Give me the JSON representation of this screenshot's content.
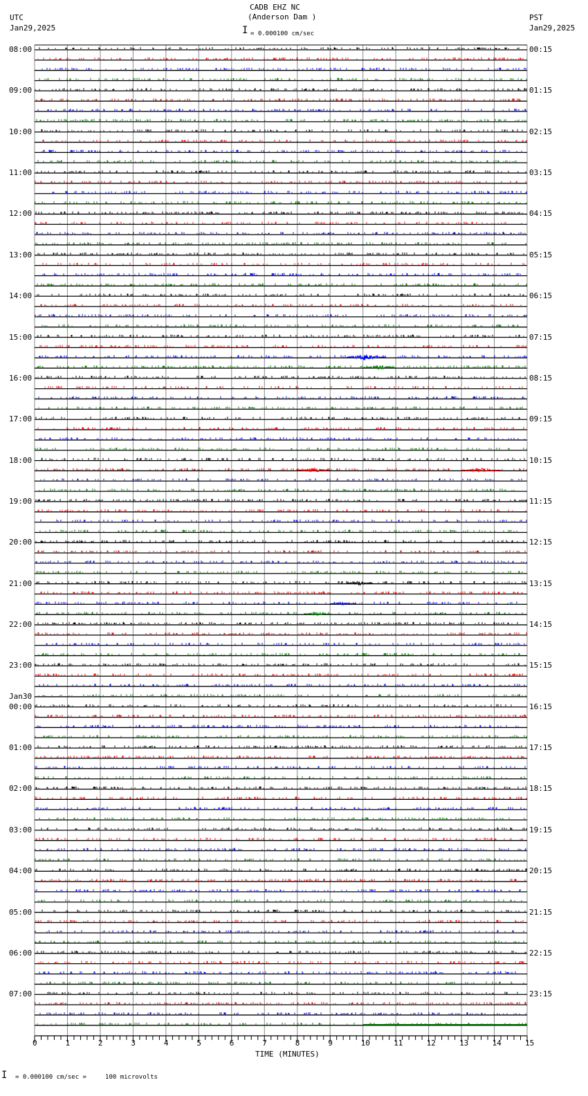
{
  "header": {
    "station": "CADB EHZ NC",
    "location": "(Anderson Dam )",
    "left_tz": "UTC",
    "left_date": "Jan29,2025",
    "right_tz": "PST",
    "right_date": "Jan29,2025",
    "scale": "= 0.000100 cm/sec"
  },
  "footer": {
    "scale": "= 0.000100 cm/sec =     100 microvolts"
  },
  "colors": {
    "cycle": [
      "#000000",
      "#ff0000",
      "#0000ff",
      "#008000"
    ],
    "grid": "#888888"
  },
  "chart_data": {
    "type": "line",
    "title": "CADB EHZ NC (Anderson Dam )",
    "xlabel": "TIME (MINUTES)",
    "xlim": [
      0,
      15
    ],
    "x_ticks": [
      "0",
      "1",
      "2",
      "3",
      "4",
      "5",
      "6",
      "7",
      "8",
      "9",
      "10",
      "11",
      "12",
      "13",
      "14",
      "15"
    ],
    "traces_per_hour": 4,
    "left_labels": [
      "08:00",
      "09:00",
      "10:00",
      "11:00",
      "12:00",
      "13:00",
      "14:00",
      "15:00",
      "16:00",
      "17:00",
      "18:00",
      "19:00",
      "20:00",
      "21:00",
      "22:00",
      "23:00",
      "00:00",
      "01:00",
      "02:00",
      "03:00",
      "04:00",
      "05:00",
      "06:00",
      "07:00"
    ],
    "date_change": {
      "label": "Jan30",
      "before_hour_index": 16
    },
    "right_labels": [
      "00:15",
      "01:15",
      "02:15",
      "03:15",
      "04:15",
      "05:15",
      "06:15",
      "07:15",
      "08:15",
      "09:15",
      "10:15",
      "11:15",
      "12:15",
      "13:15",
      "14:15",
      "15:15",
      "16:15",
      "17:15",
      "18:15",
      "19:15",
      "20:15",
      "21:15",
      "22:15",
      "23:15"
    ],
    "events": [
      {
        "trace": 30,
        "minute": 10.1,
        "amplitude": 6,
        "duration": 1.2
      },
      {
        "trace": 31,
        "minute": 10.5,
        "amplitude": 4,
        "duration": 1.0
      },
      {
        "trace": 41,
        "minute": 8.5,
        "amplitude": 4,
        "duration": 1.0
      },
      {
        "trace": 41,
        "minute": 13.6,
        "amplitude": 4,
        "duration": 1.2
      },
      {
        "trace": 52,
        "minute": 9.9,
        "amplitude": 4,
        "duration": 0.8
      },
      {
        "trace": 54,
        "minute": 9.4,
        "amplitude": 2,
        "duration": 0.8
      },
      {
        "trace": 55,
        "minute": 8.6,
        "amplitude": 4,
        "duration": 0.8
      }
    ],
    "last_trace_end_minute": 10
  }
}
